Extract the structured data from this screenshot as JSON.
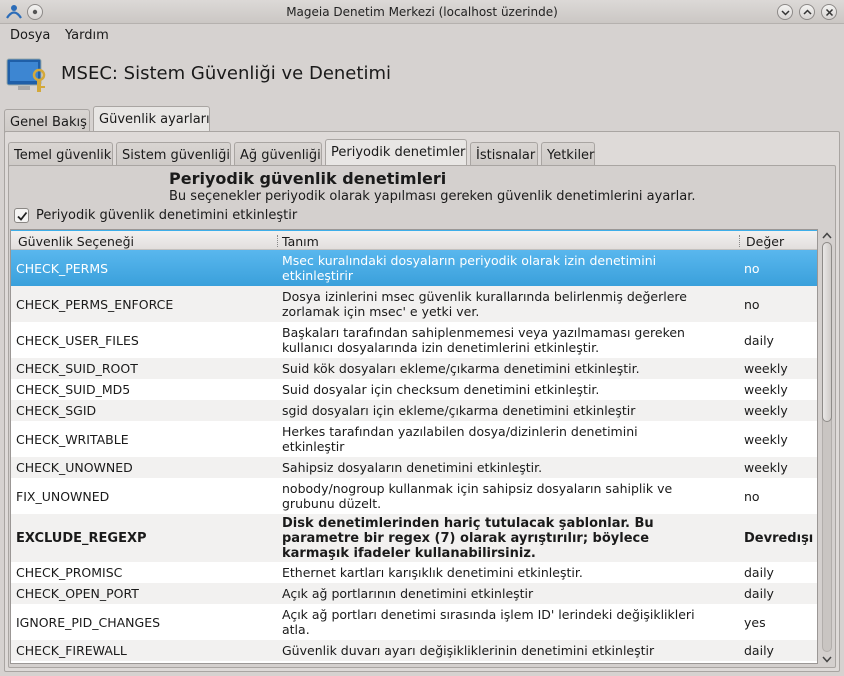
{
  "window": {
    "title": "Mageia Denetim Merkezi  (localhost üzerinde)"
  },
  "menu": {
    "items": [
      {
        "label": "Dosya"
      },
      {
        "label": "Yardım"
      }
    ]
  },
  "header": {
    "title": "MSEC: Sistem Güvenliği ve Denetimi"
  },
  "main_tabs": [
    {
      "label": "Genel Bakış"
    },
    {
      "label": "Güvenlik ayarları"
    }
  ],
  "sub_tabs": [
    {
      "label": "Temel güvenlik"
    },
    {
      "label": "Sistem güvenliği"
    },
    {
      "label": "Ağ güvenliği"
    },
    {
      "label": "Periyodik denetimler"
    },
    {
      "label": "İstisnalar"
    },
    {
      "label": "Yetkiler"
    }
  ],
  "section": {
    "heading": "Periyodik güvenlik denetimleri",
    "description": "Bu seçenekler periyodik olarak yapılması gereken güvenlik denetimlerini ayarlar.",
    "checkbox_label": "Periyodik güvenlik denetimini etkinleştir",
    "checkbox_checked": true
  },
  "table": {
    "columns": [
      "Güvenlik Seçeneği",
      "Tanım",
      "Değer"
    ],
    "rows": [
      {
        "option": "CHECK_PERMS",
        "description": "Msec kuralındaki dosyaların periyodik olarak izin denetimini etkinleştirir",
        "value": "no",
        "selected": true
      },
      {
        "option": "CHECK_PERMS_ENFORCE",
        "description": "Dosya izinlerini msec güvenlik kurallarında belirlenmiş değerlere zorlamak için msec' e yetki ver.",
        "value": "no"
      },
      {
        "option": "CHECK_USER_FILES",
        "description": "Başkaları tarafından sahiplenmemesi veya yazılmaması gereken kullanıcı dosyalarında izin denetimlerini etkinleştir.",
        "value": "daily"
      },
      {
        "option": "CHECK_SUID_ROOT",
        "description": "Suid kök dosyaları ekleme/çıkarma denetimini etkinleştir.",
        "value": "weekly"
      },
      {
        "option": "CHECK_SUID_MD5",
        "description": "Suid dosyalar için checksum denetimini etkinleştir.",
        "value": "weekly"
      },
      {
        "option": "CHECK_SGID",
        "description": "sgid dosyaları için ekleme/çıkarma denetimini etkinleştir",
        "value": "weekly"
      },
      {
        "option": "CHECK_WRITABLE",
        "description": "Herkes tarafından yazılabilen dosya/dizinlerin denetimini etkinleştir",
        "value": "weekly"
      },
      {
        "option": "CHECK_UNOWNED",
        "description": "Sahipsiz dosyaların denetimini etkinleştir.",
        "value": "weekly"
      },
      {
        "option": "FIX_UNOWNED",
        "description": "nobody/nogroup kullanmak için sahipsiz dosyaların sahiplik ve grubunu düzelt.",
        "value": "no"
      },
      {
        "option": "EXCLUDE_REGEXP",
        "description": "Disk denetimlerinden hariç tutulacak şablonlar. Bu parametre bir regex (7) olarak ayrıştırılır; böylece karmaşık ifadeler kullanabilirsiniz.",
        "value": "Devredışı",
        "bold": true
      },
      {
        "option": "CHECK_PROMISC",
        "description": "Ethernet kartları karışıklık denetimini etkinleştir.",
        "value": "daily"
      },
      {
        "option": "CHECK_OPEN_PORT",
        "description": "Açık ağ portlarının denetimini etkinleştir",
        "value": "daily"
      },
      {
        "option": "IGNORE_PID_CHANGES",
        "description": "Açık ağ portları denetimi sırasında işlem ID' lerindeki değişiklikleri atla.",
        "value": "yes"
      },
      {
        "option": "CHECK_FIREWALL",
        "description": "Güvenlik duvarı ayarı değişikliklerinin denetimini etkinleştir",
        "value": "daily"
      }
    ]
  },
  "colors": {
    "selection": "#3daee9",
    "window_bg": "#d6d2d0"
  }
}
